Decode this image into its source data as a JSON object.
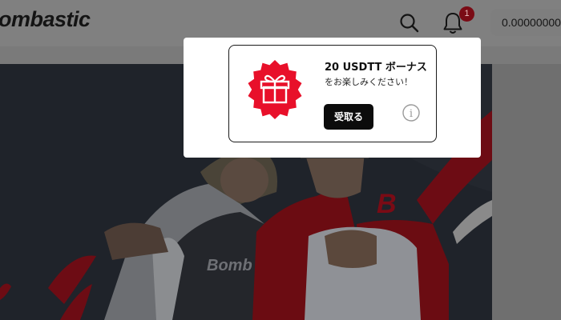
{
  "header": {
    "logo_text": "ombastic",
    "notification_count": "1",
    "balance": "0.00000000"
  },
  "hero": {
    "shirt_left_text": "Bomb",
    "shirt_right_text": "B"
  },
  "popup": {
    "title": "20 USDTT ボーナス",
    "subtitle": "をお楽しみください！",
    "claim_label": "受取る",
    "info_icon_label": "i"
  },
  "colors": {
    "brand_red": "#e8102a",
    "button_black": "#0c0c0c",
    "header_overlay": "#808080"
  },
  "icons": [
    "search-icon",
    "bell-icon",
    "gift-icon",
    "info-icon"
  ]
}
